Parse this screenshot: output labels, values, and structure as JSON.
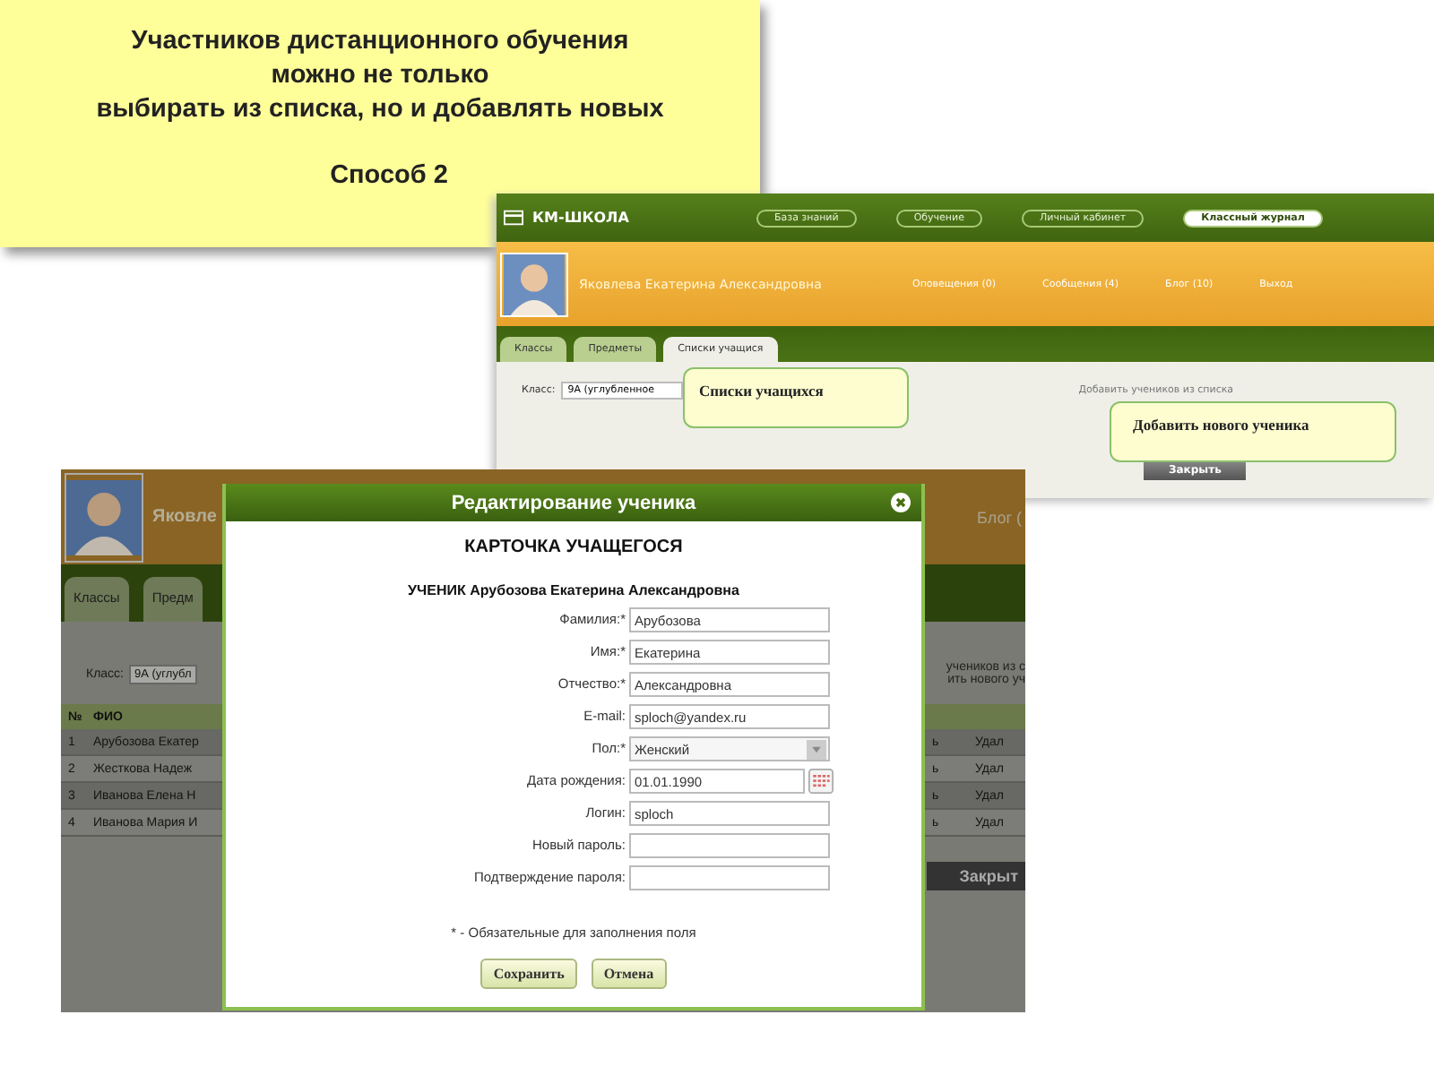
{
  "callout": {
    "lines": [
      "Участников дистанционного обучения",
      "можно не только",
      "выбирать из списка, но и добавлять новых"
    ],
    "subtitle": "Способ 2"
  },
  "portal": {
    "logo": "КМ-ШКОЛА",
    "nav": [
      {
        "label": "База знаний",
        "selected": false
      },
      {
        "label": "Обучение",
        "selected": false
      },
      {
        "label": "Личный кабинет",
        "selected": false
      },
      {
        "label": "Классный журнал",
        "selected": true
      }
    ],
    "user": "Яковлева Екатерина Александровна",
    "links": [
      "Оповещения (0)",
      "Сообщения (4)",
      "Блог (10)",
      "Выход"
    ],
    "tabs": [
      {
        "label": "Классы",
        "selected": false
      },
      {
        "label": "Предметы",
        "selected": false
      },
      {
        "label": "Списки учащися",
        "selected": true
      }
    ],
    "class_label": "Класс:",
    "class_value": "9А (углубленное",
    "add_link": "Добавить учеников из списка",
    "close_button": "Закрыть",
    "notes": [
      "Списки учащихся",
      "Добавить нового ученика"
    ]
  },
  "background_page": {
    "user": "Яковле",
    "link": "Блог (",
    "tabs": [
      "Классы",
      "Предм"
    ],
    "class_label": "Класс:",
    "class_value": "9А (углубл",
    "links": [
      "учеников из с",
      "ить нового уч"
    ],
    "columns": [
      "№",
      "ФИО"
    ],
    "rows": [
      [
        "1",
        "Арубозова Екатер",
        "ь",
        "Удал"
      ],
      [
        "2",
        "Жесткова Надеж",
        "ь",
        "Удал"
      ],
      [
        "3",
        "Иванова Елена Н",
        "ь",
        "Удал"
      ],
      [
        "4",
        "Иванова Мария И",
        "ь",
        "Удал"
      ]
    ],
    "close_button": "Закрыт"
  },
  "dialog": {
    "title": "Редактирование ученика",
    "heading": "КАРТОЧКА УЧАЩЕГОСЯ",
    "student": "УЧЕНИК Арубозова Екатерина Александровна",
    "fields": [
      {
        "kind": "text",
        "label": "Фамилия:*",
        "value": "Арубозова"
      },
      {
        "kind": "text",
        "label": "Имя:*",
        "value": "Екатерина"
      },
      {
        "kind": "text",
        "label": "Отчество:*",
        "value": "Александровна"
      },
      {
        "kind": "text",
        "label": "E-mail:",
        "value": "sploch@yandex.ru"
      },
      {
        "kind": "select",
        "label": "Пол:*",
        "value": "Женский"
      },
      {
        "kind": "date",
        "label": "Дата рождения:",
        "value": "01.01.1990"
      },
      {
        "kind": "text",
        "label": "Логин:",
        "value": "sploch"
      },
      {
        "kind": "text",
        "label": "Новый пароль:"
      },
      {
        "kind": "text",
        "label": "Подтверждение пароля:"
      }
    ],
    "note": "* - Обязательные для заполнения поля",
    "buttons": [
      "Сохранить",
      "Отмена"
    ]
  }
}
